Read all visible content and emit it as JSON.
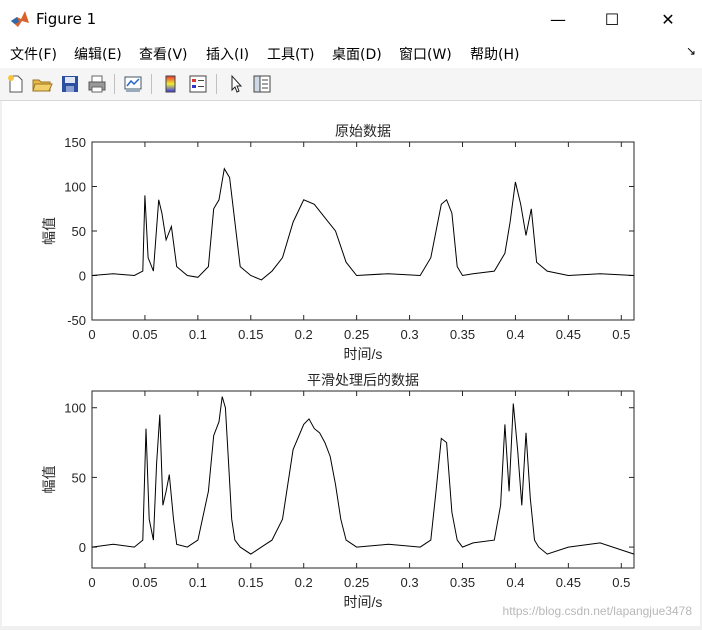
{
  "window": {
    "title": "Figure 1",
    "minimize": "—",
    "maximize": "☐",
    "close": "✕"
  },
  "menu": [
    {
      "label": "文件(F)"
    },
    {
      "label": "编辑(E)"
    },
    {
      "label": "查看(V)"
    },
    {
      "label": "插入(I)"
    },
    {
      "label": "工具(T)"
    },
    {
      "label": "桌面(D)"
    },
    {
      "label": "窗口(W)"
    },
    {
      "label": "帮助(H)"
    }
  ],
  "toolbar": [
    {
      "icon": "new-figure-icon"
    },
    {
      "icon": "open-file-icon"
    },
    {
      "icon": "save-icon"
    },
    {
      "icon": "print-icon"
    },
    {
      "icon": "link-plot-icon"
    },
    {
      "icon": "colorbar-icon"
    },
    {
      "icon": "legend-icon"
    },
    {
      "icon": "pointer-icon"
    },
    {
      "icon": "property-editor-icon"
    }
  ],
  "watermark": "https://blog.csdn.net/lapangjue3478",
  "chart_data": [
    {
      "type": "line",
      "title": "原始数据",
      "xlabel": "时间/s",
      "ylabel": "幅值",
      "xlim": [
        0,
        0.512
      ],
      "ylim": [
        -50,
        150
      ],
      "xticks": [
        "0",
        "0.05",
        "0.1",
        "0.15",
        "0.2",
        "0.25",
        "0.3",
        "0.35",
        "0.4",
        "0.45",
        "0.5"
      ],
      "yticks": [
        "-50",
        "0",
        "50",
        "100",
        "150"
      ],
      "series": [
        {
          "x": [
            0,
            0.02,
            0.04,
            0.048,
            0.05,
            0.053,
            0.058,
            0.063,
            0.066,
            0.07,
            0.075,
            0.08,
            0.09,
            0.1,
            0.11,
            0.115,
            0.12,
            0.125,
            0.13,
            0.135,
            0.14,
            0.15,
            0.16,
            0.17,
            0.18,
            0.19,
            0.2,
            0.21,
            0.22,
            0.23,
            0.24,
            0.25,
            0.28,
            0.31,
            0.32,
            0.33,
            0.335,
            0.34,
            0.345,
            0.35,
            0.36,
            0.38,
            0.39,
            0.395,
            0.4,
            0.405,
            0.41,
            0.415,
            0.42,
            0.43,
            0.45,
            0.48,
            0.512
          ],
          "values": [
            0,
            2,
            0,
            5,
            90,
            20,
            5,
            85,
            70,
            40,
            55,
            10,
            0,
            -2,
            10,
            75,
            85,
            120,
            110,
            60,
            10,
            0,
            -5,
            5,
            20,
            60,
            85,
            80,
            65,
            50,
            15,
            0,
            2,
            0,
            20,
            80,
            85,
            70,
            10,
            0,
            2,
            5,
            25,
            60,
            105,
            80,
            45,
            75,
            15,
            5,
            0,
            2,
            0
          ]
        }
      ]
    },
    {
      "type": "line",
      "title": "平滑处理后的数据",
      "xlabel": "时间/s",
      "ylabel": "幅值",
      "xlim": [
        0,
        0.512
      ],
      "ylim": [
        -15,
        112
      ],
      "xticks": [
        "0",
        "0.05",
        "0.1",
        "0.15",
        "0.2",
        "0.25",
        "0.3",
        "0.35",
        "0.4",
        "0.45",
        "0.5"
      ],
      "yticks": [
        "0",
        "50",
        "100"
      ],
      "series": [
        {
          "x": [
            0,
            0.02,
            0.04,
            0.048,
            0.051,
            0.054,
            0.058,
            0.061,
            0.064,
            0.067,
            0.07,
            0.073,
            0.077,
            0.08,
            0.09,
            0.1,
            0.11,
            0.115,
            0.12,
            0.123,
            0.126,
            0.129,
            0.132,
            0.135,
            0.14,
            0.15,
            0.16,
            0.17,
            0.18,
            0.19,
            0.2,
            0.205,
            0.21,
            0.215,
            0.22,
            0.225,
            0.23,
            0.235,
            0.24,
            0.25,
            0.28,
            0.31,
            0.32,
            0.325,
            0.33,
            0.335,
            0.34,
            0.345,
            0.35,
            0.36,
            0.38,
            0.386,
            0.39,
            0.394,
            0.398,
            0.402,
            0.406,
            0.41,
            0.414,
            0.418,
            0.422,
            0.43,
            0.45,
            0.48,
            0.512
          ],
          "values": [
            0,
            2,
            0,
            5,
            85,
            20,
            5,
            60,
            95,
            30,
            40,
            52,
            20,
            2,
            0,
            5,
            40,
            80,
            90,
            108,
            100,
            60,
            20,
            5,
            0,
            -5,
            0,
            5,
            20,
            70,
            88,
            92,
            85,
            82,
            75,
            65,
            45,
            20,
            5,
            0,
            2,
            0,
            5,
            40,
            78,
            75,
            25,
            5,
            0,
            3,
            5,
            30,
            88,
            40,
            103,
            70,
            30,
            82,
            35,
            5,
            0,
            -5,
            0,
            3,
            -5
          ]
        }
      ]
    }
  ]
}
